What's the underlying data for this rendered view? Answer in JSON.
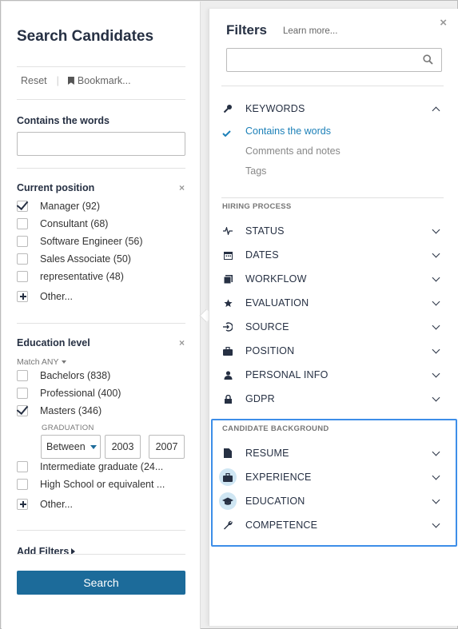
{
  "left": {
    "title": "Search Candidates",
    "reset_label": "Reset",
    "bookmark_label": "Bookmark...",
    "contains_title": "Contains the words",
    "contains_value": "",
    "current_position": {
      "title": "Current position",
      "items": [
        {
          "label": "Manager (92)",
          "checked": true
        },
        {
          "label": "Consultant (68)",
          "checked": false
        },
        {
          "label": "Software Engineer (56)",
          "checked": false
        },
        {
          "label": "Sales Associate (50)",
          "checked": false
        },
        {
          "label": "representative (48)",
          "checked": false
        }
      ],
      "other_label": "Other..."
    },
    "education": {
      "title": "Education level",
      "match_label": "Match ANY",
      "items": [
        {
          "label": "Bachelors (838)",
          "checked": false
        },
        {
          "label": "Professional (400)",
          "checked": false
        },
        {
          "label": "Masters (346)",
          "checked": true
        }
      ],
      "graduation_label": "GRADUATION",
      "graduation_mode": "Between",
      "year_from": "2003",
      "year_to": "2007",
      "items_after": [
        {
          "label": "Intermediate graduate (24...",
          "checked": false
        },
        {
          "label": "High School or equivalent ...",
          "checked": false
        }
      ],
      "other_label": "Other..."
    },
    "add_filters_label": "Add Filters",
    "search_label": "Search"
  },
  "right": {
    "title": "Filters",
    "learn_more": "Learn more...",
    "close_glyph": "×",
    "search_value": "",
    "keywords": {
      "label": "KEYWORDS",
      "subitems": [
        "Contains the words",
        "Comments and notes",
        "Tags"
      ]
    },
    "hiring_process_label": "HIRING PROCESS",
    "hiring_items": [
      "STATUS",
      "DATES",
      "WORKFLOW",
      "EVALUATION",
      "SOURCE",
      "POSITION",
      "PERSONAL INFO",
      "GDPR"
    ],
    "candidate_background_label": "CANDIDATE BACKGROUND",
    "background_items": [
      "RESUME",
      "EXPERIENCE",
      "EDUCATION",
      "COMPETENCE"
    ]
  },
  "colors": {
    "primary": "#1c6b9a",
    "link_active": "#1c80b8",
    "highlight": "#3d8ee8",
    "heading": "#263043"
  },
  "close_glyph": "×"
}
